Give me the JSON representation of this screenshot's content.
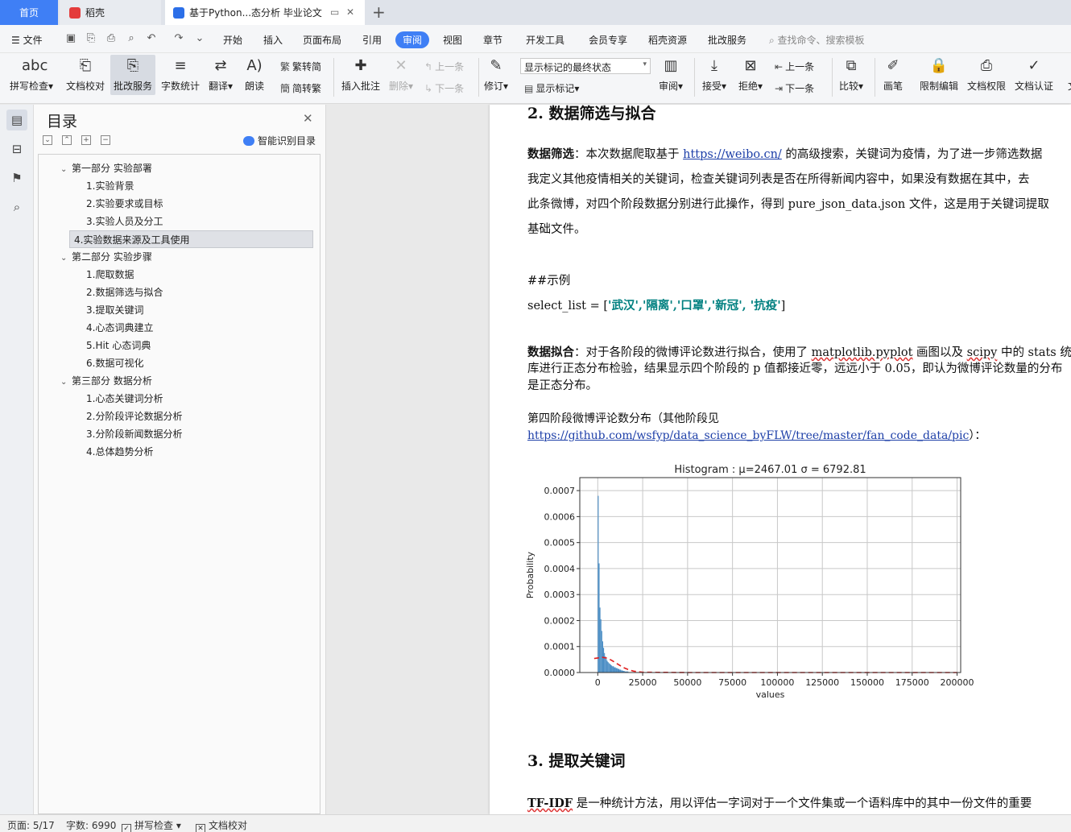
{
  "tabs": {
    "home": "首页",
    "docer": "稻壳",
    "document": "基于Python...态分析 毕业论文"
  },
  "menu": {
    "file": "文件",
    "items": [
      "开始",
      "插入",
      "页面布局",
      "引用",
      "审阅",
      "视图",
      "章节",
      "开发工具",
      "会员专享",
      "稻壳资源",
      "批改服务"
    ],
    "search_placeholder": "查找命令、搜索模板"
  },
  "ribbon": {
    "spellcheck": "拼写检查",
    "doc_proof": "文档校对",
    "correction_service": "批改服务",
    "word_count": "字数统计",
    "translate": "翻译",
    "read_aloud": "朗读",
    "trad_to_simp": "繁转简",
    "simp_to_trad": "简转繁",
    "insert_comment": "插入批注",
    "delete": "删除",
    "prev_comment": "上一条",
    "next_comment": "下一条",
    "track_changes": "修订",
    "markup_state": "显示标记的最终状态",
    "show_markup": "显示标记",
    "review_pane": "审阅",
    "accept": "接受",
    "reject": "拒绝",
    "prev_change": "上一条",
    "next_change": "下一条",
    "compare": "比较",
    "pen": "画笔",
    "restrict_edit": "限制编辑",
    "doc_permission": "文档权限",
    "doc_certify": "文档认证",
    "more": "文"
  },
  "toc": {
    "title": "目录",
    "smart_recognize": "智能识别目录",
    "items": [
      {
        "label": "第一部分  实验部署",
        "level": 1
      },
      {
        "label": "1.实验背景",
        "level": 2
      },
      {
        "label": "2.实验要求或目标",
        "level": 2
      },
      {
        "label": "3.实验人员及分工",
        "level": 2
      },
      {
        "label": "4.实验数据来源及工具使用",
        "level": 2,
        "selected": true
      },
      {
        "label": "第二部分  实验步骤",
        "level": 1
      },
      {
        "label": "1.爬取数据",
        "level": 2
      },
      {
        "label": "2.数据筛选与拟合",
        "level": 2
      },
      {
        "label": "3.提取关键词",
        "level": 2
      },
      {
        "label": "4.心态词典建立",
        "level": 2
      },
      {
        "label": "5.Hit 心态词典",
        "level": 2
      },
      {
        "label": "6.数据可视化",
        "level": 2
      },
      {
        "label": "第三部分  数据分析",
        "level": 1
      },
      {
        "label": "1.心态关键词分析",
        "level": 2
      },
      {
        "label": "2.分阶段评论数据分析",
        "level": 2
      },
      {
        "label": "3.分阶段新闻数据分析",
        "level": 2
      },
      {
        "label": "4.总体趋势分析",
        "level": 2
      }
    ]
  },
  "doc": {
    "heading2": "2.  数据筛选与拟合",
    "p1_label": "数据筛选",
    "p1_a": "：本次数据爬取基于 ",
    "p1_link": "https://weibo.cn/",
    "p1_b": " 的高级搜索，关键词为疫情，为了进一步筛选数据",
    "p1_line2": "我定义其他疫情相关的关键词，检查关键词列表是否在所得新闻内容中，如果没有数据在其中，去",
    "p1_line3": "此条微博，对四个阶段数据分别进行此操作，得到 pure_json_data.json 文件，这是用于关键词提取",
    "p1_line4": "基础文件。",
    "example_label": "##示例",
    "code_prefix": "select_list = [",
    "code_items": "'武汉','隔离','口罩','新冠', '抗疫'",
    "code_suffix": "]",
    "p2_label": "数据拟合",
    "p2_a": "：对于各阶段的微博评论数进行拟合，使用了 ",
    "p2_lib1": "matplotlib.pyplot",
    "p2_b": " 画图以及 ",
    "p2_lib2": "scipy",
    "p2_c": " 中的 stats 统",
    "p2_line2": "库进行正态分布检验，结果显示四个阶段的 p 值都接近零，远远小于 0.05，即认为微博评论数量的分布",
    "p2_line3": "是正态分布。",
    "fig_caption": "第四阶段微博评论数分布（其他阶段见",
    "fig_link": "https://github.com/wsfyp/data_science_byFLW/tree/master/fan_code_data/pic",
    "fig_link_suffix": "）：",
    "heading3": "3.  提取关键词",
    "p3_label": "TF-IDF",
    "p3_text": " 是一种统计方法，用以评估一字词对于一个文件集或一个语料库中的其中一份文件的重要"
  },
  "chart_data": {
    "type": "bar",
    "title": "Histogram : μ=2467.01 σ = 6792.81",
    "xlabel": "values",
    "ylabel": "Probability",
    "xlim": [
      -10000,
      202000
    ],
    "ylim": [
      0,
      0.00075
    ],
    "xticks": [
      0,
      25000,
      50000,
      75000,
      100000,
      125000,
      150000,
      175000,
      200000
    ],
    "xtick_labels": [
      "0",
      "25000",
      "50000",
      "75000",
      "100000",
      "125000",
      "150000",
      "175000",
      "200000"
    ],
    "yticks": [
      0,
      0.0001,
      0.0002,
      0.0003,
      0.0004,
      0.0005,
      0.0006,
      0.0007
    ],
    "ytick_labels": [
      "0.0000",
      "0.0001",
      "0.0002",
      "0.0003",
      "0.0004",
      "0.0005",
      "0.0006",
      "0.0007"
    ],
    "grid": true,
    "histogram": {
      "bin_width": 500,
      "x": [
        0,
        500,
        1000,
        1500,
        2000,
        2500,
        3000,
        3500,
        4000,
        4500,
        5000,
        5500,
        6000,
        6500,
        7000,
        7500,
        8000,
        9000,
        10000,
        11000,
        12000,
        13000,
        14000,
        15000,
        17000
      ],
      "values": [
        0.00068,
        0.00042,
        0.00025,
        0.000205,
        0.00016,
        0.00012,
        9.5e-05,
        7.5e-05,
        6.2e-05,
        5.2e-05,
        4.5e-05,
        4e-05,
        3.6e-05,
        3.3e-05,
        3e-05,
        2.7e-05,
        2.4e-05,
        2e-05,
        1.7e-05,
        1.4e-05,
        1.1e-05,
        8e-06,
        6e-06,
        4e-06,
        2e-06
      ]
    },
    "fit_curve": {
      "style": "dashed",
      "color": "#e01c1c",
      "x": [
        -2000,
        0,
        2500,
        5000,
        7500,
        10000,
        12500,
        15000,
        17500,
        20000,
        25000,
        50000,
        100000,
        150000,
        200000
      ],
      "values": [
        5.4e-05,
        5.6e-05,
        5.87e-05,
        5.55e-05,
        4.78e-05,
        3.73e-05,
        2.65e-05,
        1.7e-05,
        9.9e-06,
        5.2e-06,
        1.1e-06,
        0,
        0,
        0,
        0
      ]
    },
    "bar_color": "#4a8dc4"
  },
  "status": {
    "page": "页面: 5/17",
    "word_count": "字数: 6990",
    "spellcheck": "拼写检查",
    "doc_proof": "文档校对"
  }
}
